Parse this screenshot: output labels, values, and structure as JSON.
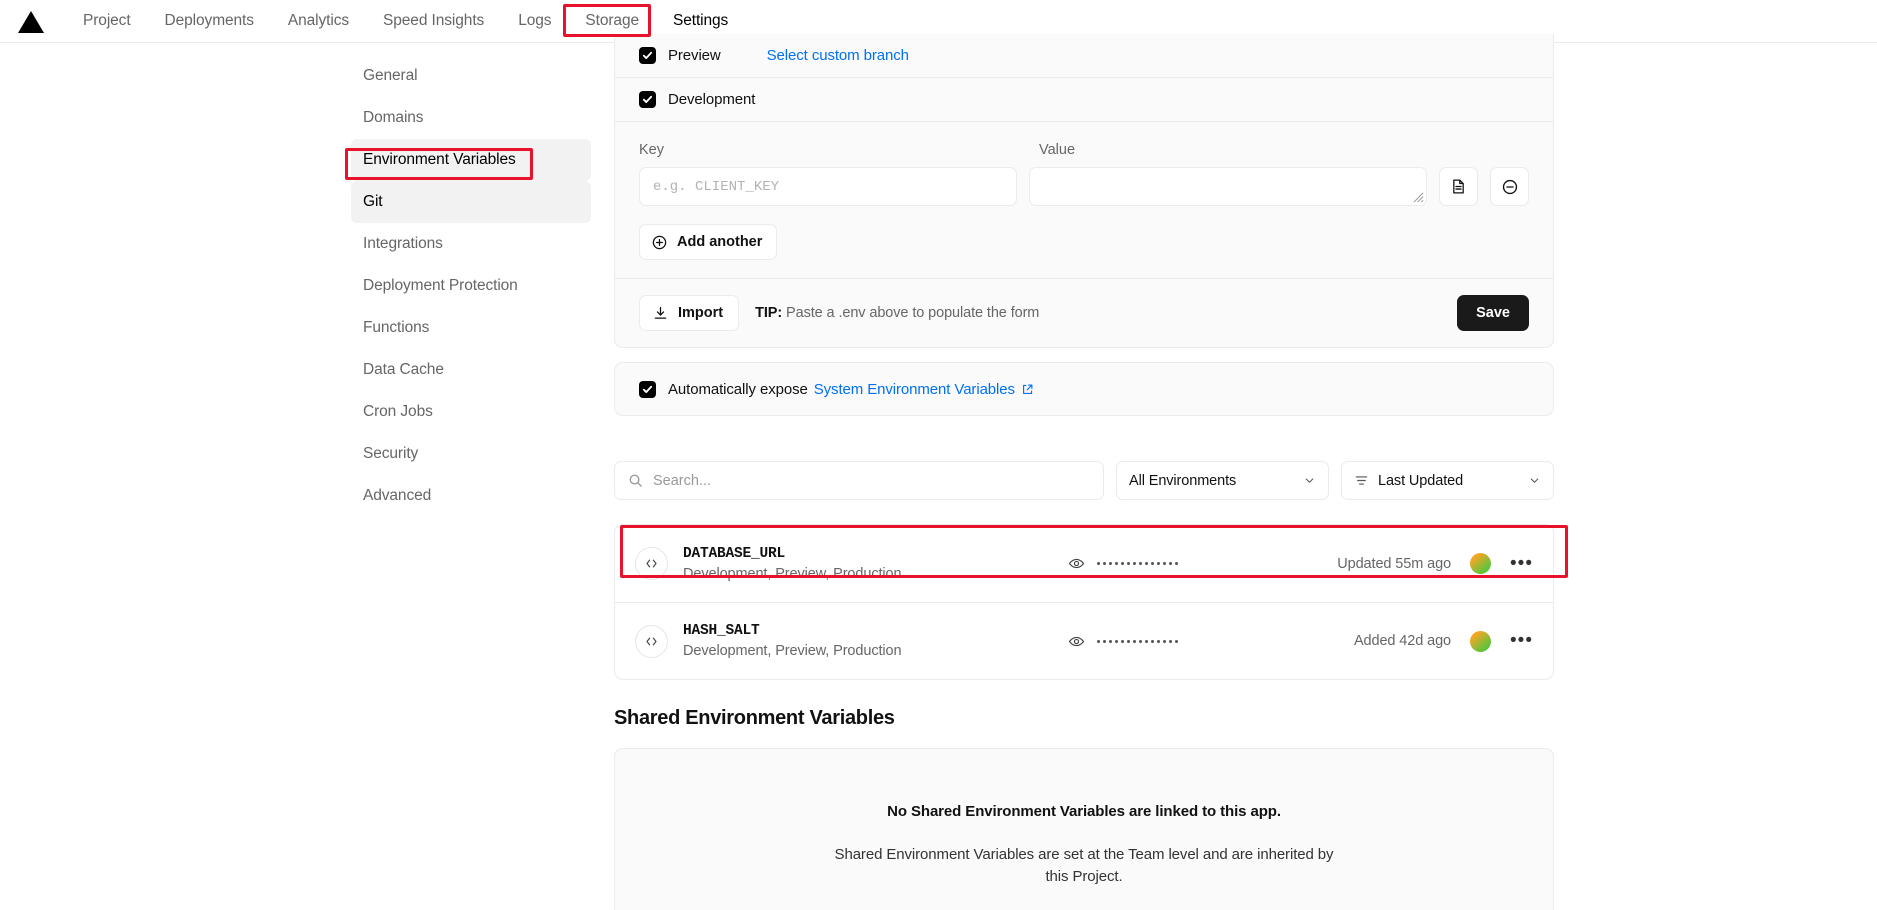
{
  "topnav": {
    "logo": "vercel-triangle-logo",
    "items": [
      {
        "label": "Project",
        "active": false
      },
      {
        "label": "Deployments",
        "active": false
      },
      {
        "label": "Analytics",
        "active": false
      },
      {
        "label": "Speed Insights",
        "active": false
      },
      {
        "label": "Logs",
        "active": false
      },
      {
        "label": "Storage",
        "active": false
      },
      {
        "label": "Settings",
        "active": true
      }
    ]
  },
  "sidebar": {
    "items": [
      {
        "label": "General"
      },
      {
        "label": "Domains"
      },
      {
        "label": "Environment Variables"
      },
      {
        "label": "Git"
      },
      {
        "label": "Integrations"
      },
      {
        "label": "Deployment Protection"
      },
      {
        "label": "Functions"
      },
      {
        "label": "Data Cache"
      },
      {
        "label": "Cron Jobs"
      },
      {
        "label": "Security"
      },
      {
        "label": "Advanced"
      }
    ]
  },
  "env_form": {
    "preview_label": "Preview",
    "select_branch_link": "Select custom branch",
    "development_label": "Development",
    "key_header": "Key",
    "value_header": "Value",
    "key_placeholder": "e.g. CLIENT_KEY",
    "value_text": "",
    "add_another_label": "Add another",
    "import_label": "Import",
    "tip_prefix": "TIP:",
    "tip_text": "Paste a .env above to populate the form",
    "save_label": "Save"
  },
  "expose": {
    "label": "Automatically expose",
    "link_label": "System Environment Variables",
    "checked": true
  },
  "toolbar": {
    "search_placeholder": "Search...",
    "environment_filter": "All Environments",
    "sort_filter": "Last Updated"
  },
  "variables": [
    {
      "name": "DATABASE_URL",
      "environments": "Development, Preview, Production",
      "value_masked": "••••••••••••••",
      "timestamp": "Updated 55m ago"
    },
    {
      "name": "HASH_SALT",
      "environments": "Development, Preview, Production",
      "value_masked": "••••••••••••••",
      "timestamp": "Added 42d ago"
    }
  ],
  "shared": {
    "title": "Shared Environment Variables",
    "empty_heading": "No Shared Environment Variables are linked to this app.",
    "empty_body": "Shared Environment Variables are set at the Team level and are inherited by this Project."
  },
  "colors": {
    "accent_link": "#0070f3",
    "annotation": "#e8122a",
    "dark_button": "#1a1a1a"
  }
}
